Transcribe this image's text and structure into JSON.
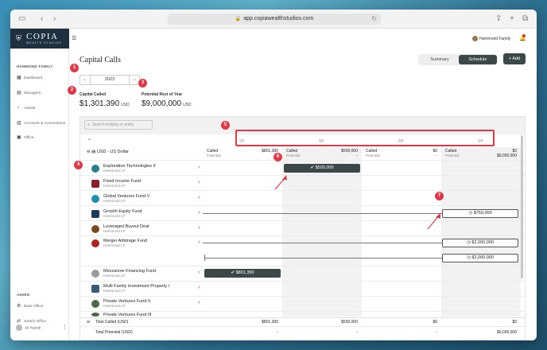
{
  "browser": {
    "url": "app.copiawealthstudios.com"
  },
  "brand": {
    "name": "COPIA",
    "sub": "WEALTH STUDIOS"
  },
  "sidebar": {
    "section": "HAMMOND FAMILY",
    "items": [
      {
        "label": "Dashboard",
        "icon": "grid-icon"
      },
      {
        "label": "Managers",
        "icon": "folder-icon"
      },
      {
        "label": "Assets",
        "icon": "pie-icon"
      },
      {
        "label": "Accounts & Connections",
        "icon": "bank-icon"
      },
      {
        "label": "Office",
        "icon": "office-icon"
      }
    ],
    "admin_heading": "ADMIN",
    "admin_items": [
      {
        "label": "Back Office",
        "icon": "gear-icon"
      },
      {
        "label": "Switch Office",
        "icon": "swap-icon"
      }
    ],
    "user": "Ali Razak"
  },
  "header": {
    "title": "Capital Calls",
    "family": "Hammond Family",
    "tabs": [
      "Summary",
      "Schedule"
    ],
    "add_label": "Add"
  },
  "year": "2023",
  "stats": {
    "called_label": "Capital Called",
    "called_value": "$1,301,390",
    "called_unit": "USD",
    "potential_label": "Potential Rest of Year",
    "potential_value": "$9,000,000",
    "potential_unit": "USD"
  },
  "search": {
    "placeholder": "Search holding or entity"
  },
  "quarters": [
    "Q1",
    "Q2",
    "Q3",
    "Q4"
  ],
  "group_label": "USD - US Dollar",
  "quarter_summary": [
    {
      "called": "$801,390",
      "potential": "-"
    },
    {
      "called": "$500,000",
      "potential": "-"
    },
    {
      "called": "$0",
      "potential": "-"
    },
    {
      "called": "$0",
      "potential": "$9,000,000"
    }
  ],
  "labels": {
    "called": "Called",
    "potential": "Potential"
  },
  "funds": [
    {
      "name": "Exploration Technologies II",
      "entity": "Hammond LP",
      "color": "#2a7f8a"
    },
    {
      "name": "Fixed Income Fund",
      "entity": "Hammond LP",
      "color": "#8a1f2a"
    },
    {
      "name": "Global Ventures Fund V",
      "entity": "Hammond LP",
      "color": "#1d8fb0"
    },
    {
      "name": "Growth Equity Fund",
      "entity": "Hammond LP",
      "color": "#1f3a5a"
    },
    {
      "name": "Leveraged Buyout Deal",
      "entity": "Hammond LP",
      "color": "#7a4a1a"
    },
    {
      "name": "Merger Arbitrage Fund",
      "entity": "Hammond LP",
      "color": "#b02020"
    },
    {
      "name": "Mezzanine Financing Fund",
      "entity": "Hammond LP",
      "color": "#9a9a9a"
    },
    {
      "name": "Multi Family Investment Property I",
      "entity": "Hammond LP",
      "color": "#3a5a7a"
    },
    {
      "name": "Private Ventures Fund II",
      "entity": "Hammond LP",
      "color": "#4a6a4a"
    },
    {
      "name": "Private Ventures Fund III",
      "entity": "",
      "color": "#4a6a4a"
    }
  ],
  "calls": {
    "exploration": "$500,000",
    "growth": "$750,000",
    "merger_a": "$2,000,000",
    "merger_b": "$2,000,000",
    "mezzanine": "$801,390"
  },
  "totals": {
    "called_label": "Total Called (USD)",
    "potential_label": "Total Potential (USD)",
    "called": [
      "$801,390",
      "$500,000",
      "$0",
      "$0"
    ],
    "potential": [
      "-",
      "-",
      "-",
      "$9,000,000"
    ]
  },
  "badges": [
    "1",
    "2",
    "3",
    "4",
    "5",
    "6",
    "7"
  ],
  "colors": {
    "accent": "#e03a48",
    "dark": "#3c4848",
    "brand": "#1e3040"
  }
}
